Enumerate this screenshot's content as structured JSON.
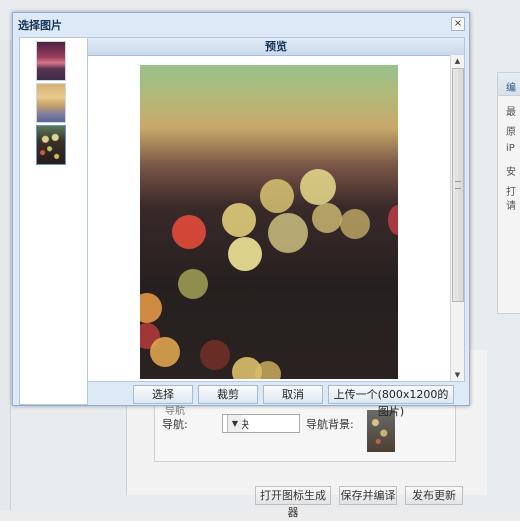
{
  "dialog": {
    "title": "选择图片",
    "close_glyph": "×",
    "preview_header": "预览",
    "buttons": {
      "select": "选择",
      "crop": "裁剪",
      "cancel": "取消",
      "upload": "上传一个(800x1200的图片)"
    },
    "scroll_up_glyph": "▲",
    "scroll_down_glyph": "▼"
  },
  "background": {
    "right_panel_text": [
      "编",
      "最",
      "原",
      "iP",
      "安",
      "打",
      "请"
    ],
    "nav_label": "导航:",
    "nav_select_value": "方块",
    "nav_select_arrow": "▼",
    "nav_bg_label": "导航背景:",
    "partial_label": "导航",
    "bottom_buttons": {
      "open_generator": "打开图标生成器",
      "save_compile": "保存并编译",
      "publish": "发布更新"
    }
  },
  "icons": {
    "close": "close-icon",
    "scroll_up": "chevron-up-icon",
    "scroll_down": "chevron-down-icon",
    "dropdown": "chevron-down-icon"
  },
  "colors": {
    "dialog_bg": "#dde9f6",
    "dialog_border": "#8eaed2",
    "title_text": "#15345a"
  }
}
